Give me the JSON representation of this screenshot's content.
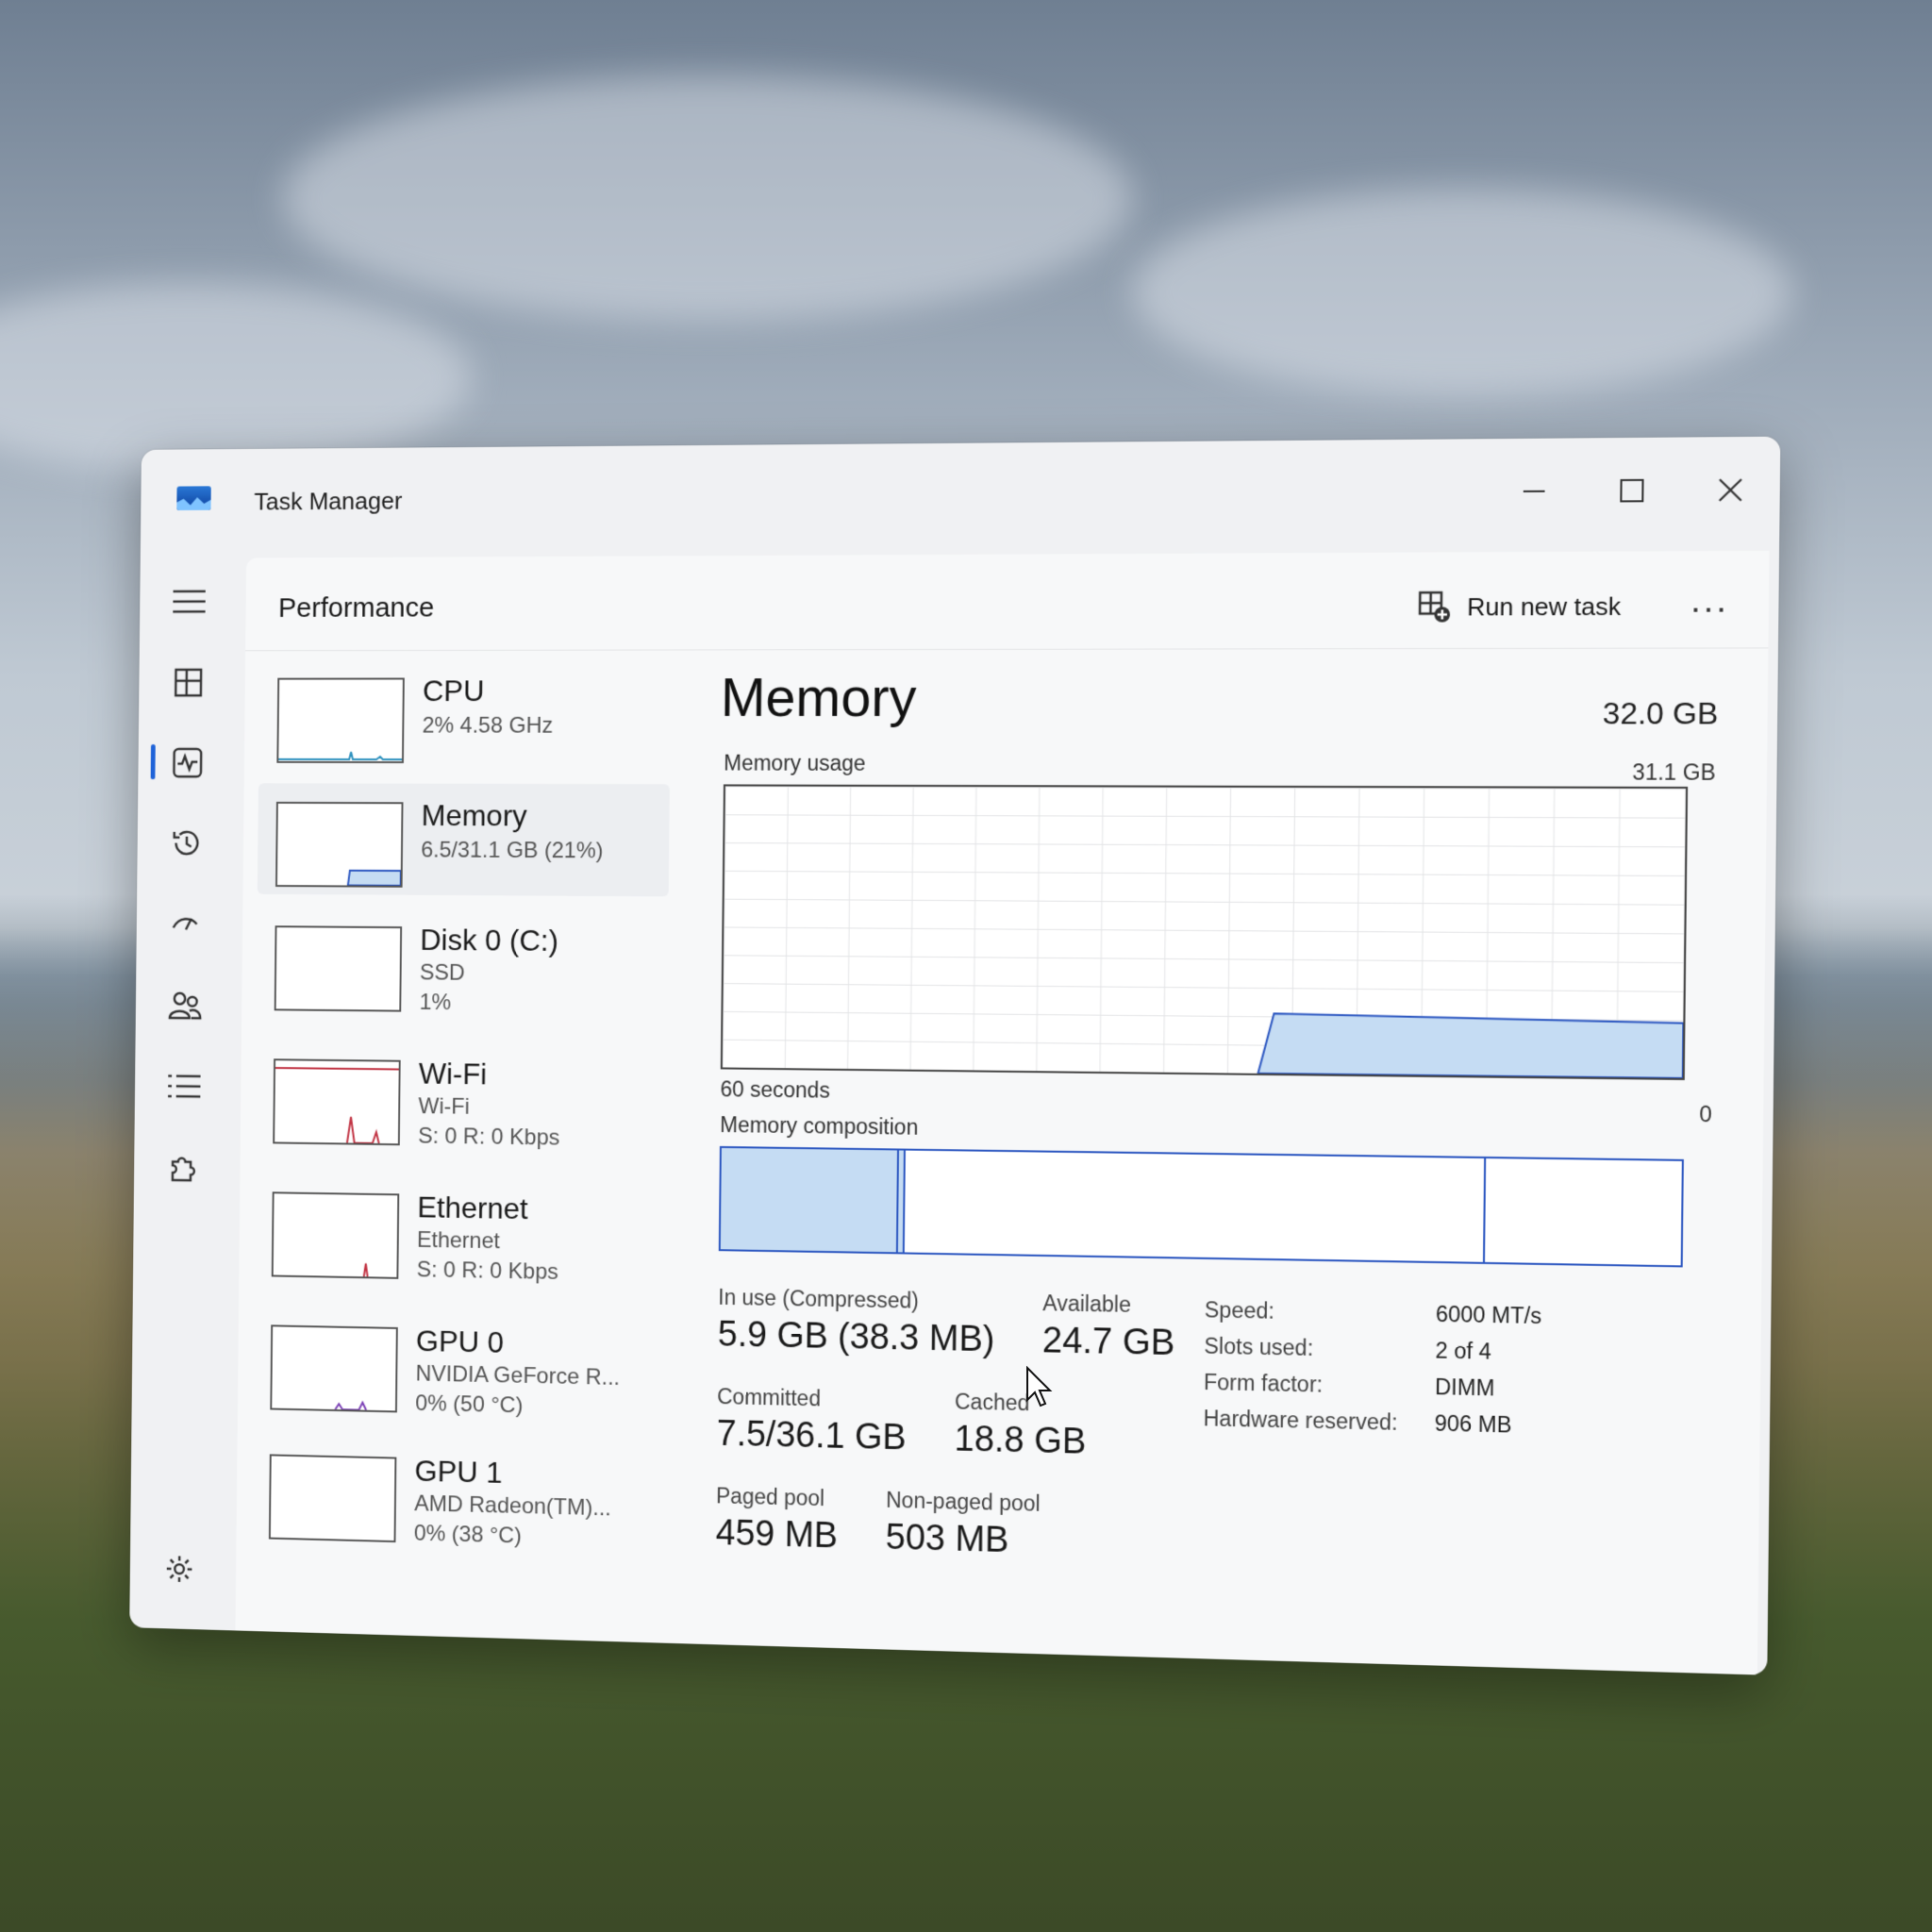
{
  "window": {
    "title": "Task Manager"
  },
  "header": {
    "title": "Performance",
    "run_task_label": "Run new task",
    "more_label": "..."
  },
  "devices": [
    {
      "name": "CPU",
      "line1": "2% 4.58 GHz",
      "line2": ""
    },
    {
      "name": "Memory",
      "line1": "6.5/31.1 GB (21%)",
      "line2": ""
    },
    {
      "name": "Disk 0 (C:)",
      "line1": "SSD",
      "line2": "1%"
    },
    {
      "name": "Wi-Fi",
      "line1": "Wi-Fi",
      "line2": "S: 0 R: 0 Kbps"
    },
    {
      "name": "Ethernet",
      "line1": "Ethernet",
      "line2": "S: 0 R: 0 Kbps"
    },
    {
      "name": "GPU 0",
      "line1": "NVIDIA GeForce R...",
      "line2": "0% (50 °C)"
    },
    {
      "name": "GPU 1",
      "line1": "AMD Radeon(TM)...",
      "line2": "0% (38 °C)"
    }
  ],
  "memory": {
    "title": "Memory",
    "total": "32.0 GB",
    "usage_label": "Memory usage",
    "usage_max": "31.1 GB",
    "time_left": "60 seconds",
    "time_right": "0",
    "composition_label": "Memory composition",
    "composition": {
      "in_use_gb": 5.9,
      "modified_gb": 0.2,
      "standby_gb": 18.8,
      "free_gb": 6.2
    },
    "usage_fraction_current": 0.21,
    "stats": {
      "in_use_label": "In use (Compressed)",
      "in_use_value": "5.9 GB (38.3 MB)",
      "available_label": "Available",
      "available_value": "24.7 GB",
      "committed_label": "Committed",
      "committed_value": "7.5/36.1 GB",
      "cached_label": "Cached",
      "cached_value": "18.8 GB",
      "paged_label": "Paged pool",
      "paged_value": "459 MB",
      "nonpaged_label": "Non-paged pool",
      "nonpaged_value": "503 MB"
    },
    "specs": {
      "speed_label": "Speed:",
      "speed_value": "6000 MT/s",
      "slots_label": "Slots used:",
      "slots_value": "2 of 4",
      "form_label": "Form factor:",
      "form_value": "DIMM",
      "reserved_label": "Hardware reserved:",
      "reserved_value": "906 MB"
    }
  },
  "colors": {
    "accent": "#1f63d8",
    "graph_fill": "#c5dcf3",
    "graph_line": "#2a55c0"
  }
}
